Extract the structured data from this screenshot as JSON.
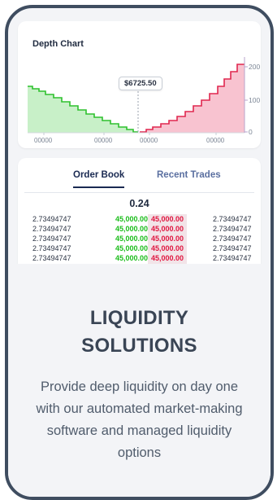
{
  "depth_chart": {
    "title": "Depth Chart",
    "mid_price": "$6725.50",
    "x_ticks": [
      "00000",
      "00000",
      "00000",
      "00000"
    ],
    "y_ticks": [
      "200",
      "100",
      "0"
    ],
    "colors": {
      "bid_fill": "#c8f0c8",
      "bid_line": "#2ec12e",
      "ask_fill": "#f8c3d0",
      "ask_line": "#e0274f",
      "axis": "#b8a4cc"
    }
  },
  "order_book": {
    "tabs": [
      "Order Book",
      "Recent Trades"
    ],
    "active_tab": "Order Book",
    "spread": "0.24",
    "rows": [
      {
        "amount_left": "2.73494747",
        "bid": "45,000.00",
        "ask": "45,000.00",
        "amount_right": "2.73494747"
      },
      {
        "amount_left": "2.73494747",
        "bid": "45,000.00",
        "ask": "45,000.00",
        "amount_right": "2.73494747"
      },
      {
        "amount_left": "2.73494747",
        "bid": "45,000.00",
        "ask": "45,000.00",
        "amount_right": "2.73494747"
      },
      {
        "amount_left": "2.73494747",
        "bid": "45,000.00",
        "ask": "45,000.00",
        "amount_right": "2.73494747"
      },
      {
        "amount_left": "2.73494747",
        "bid": "45,000.00",
        "ask": "45,000.00",
        "amount_right": "2.73494747"
      }
    ]
  },
  "promo": {
    "title_line1": "LIQUIDITY",
    "title_line2": "SOLUTIONS",
    "description": "Provide deep liquidity on day one with our automated market-making software and managed liquidity options"
  }
}
